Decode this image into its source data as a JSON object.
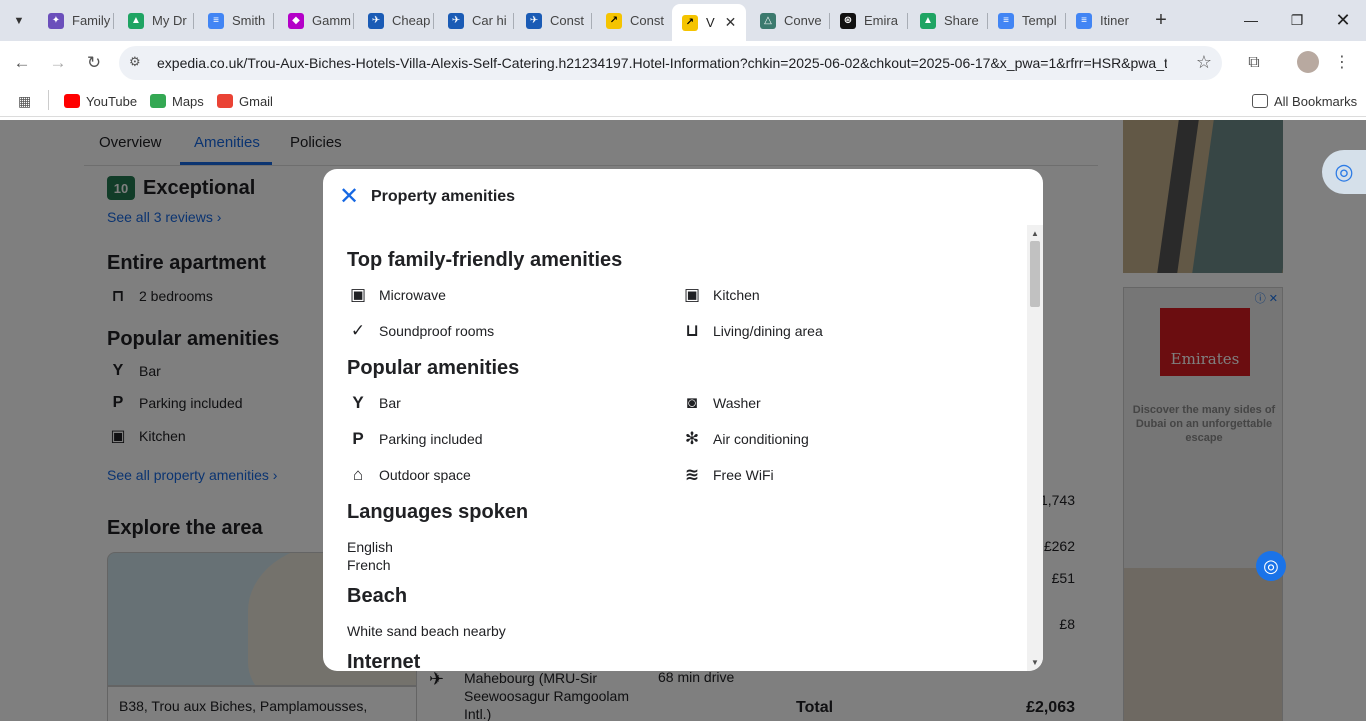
{
  "browser": {
    "tabs": [
      {
        "label": "Family",
        "color": "#6b4fbb"
      },
      {
        "label": "My Dr",
        "color": "#1fa463"
      },
      {
        "label": "Smith",
        "color": "#4285f4"
      },
      {
        "label": "Gamm",
        "color": "#b400c8"
      },
      {
        "label": "Cheap",
        "color": "#1a5bb5"
      },
      {
        "label": "Car hi",
        "color": "#1a5bb5"
      },
      {
        "label": "Const",
        "color": "#1a5bb5"
      },
      {
        "label": "Const",
        "color": "#f5c400"
      },
      {
        "label": "V",
        "color": "#f5c400"
      },
      {
        "label": "Conve",
        "color": "#3c7a6e"
      },
      {
        "label": "Emira",
        "color": "#111111"
      },
      {
        "label": "Share",
        "color": "#1fa463"
      },
      {
        "label": "Templ",
        "color": "#4285f4"
      },
      {
        "label": "Itiner",
        "color": "#4285f4"
      }
    ],
    "url": "expedia.co.uk/Trou-Aux-Biches-Hotels-Villa-Alexis-Self-Catering.h21234197.Hotel-Information?chkin=2025-06-02&chkout=2025-06-17&x_pwa=1&rfrr=HSR&pwa_t...",
    "bookmarks": {
      "youtube": "YouTube",
      "maps": "Maps",
      "gmail": "Gmail",
      "all": "All Bookmarks"
    }
  },
  "page": {
    "subnav": {
      "overview": "Overview",
      "amenities": "Amenities",
      "policies": "Policies"
    },
    "score": "10",
    "score_text": "Exceptional",
    "reviews_link": "See all 3 reviews",
    "property_type": "Entire apartment",
    "bedrooms": "2 bedrooms",
    "popular_heading": "Popular amenities",
    "popular": [
      "Bar",
      "Parking included",
      "Kitchen"
    ],
    "see_all_amenities": "See all property amenities",
    "explore_heading": "Explore the area",
    "address": "B38, Trou aux Biches, Pamplamousses,",
    "flight": {
      "place": "Mahebourg (MRU-Sir Seewoosagur Ramgoolam Intl.)",
      "drive": "68 min drive"
    },
    "prices": [
      "£1,743",
      "£262",
      "£51",
      "£8"
    ],
    "total_label": "Total",
    "total_value": "£2,063",
    "ad": {
      "brand": "Emirates",
      "tagline": "Discover the many sides of Dubai on an unforgettable escape"
    }
  },
  "modal": {
    "title": "Property amenities",
    "sections": {
      "family": {
        "heading": "Top family-friendly amenities",
        "items": [
          "Microwave",
          "Kitchen",
          "Soundproof rooms",
          "Living/dining area"
        ]
      },
      "popular": {
        "heading": "Popular amenities",
        "items": [
          "Bar",
          "Washer",
          "Parking included",
          "Air conditioning",
          "Outdoor space",
          "Free WiFi"
        ]
      },
      "languages": {
        "heading": "Languages spoken",
        "items": [
          "English",
          "French"
        ]
      },
      "beach": {
        "heading": "Beach",
        "items": [
          "White sand beach nearby"
        ]
      },
      "internet": {
        "heading": "Internet"
      }
    }
  }
}
